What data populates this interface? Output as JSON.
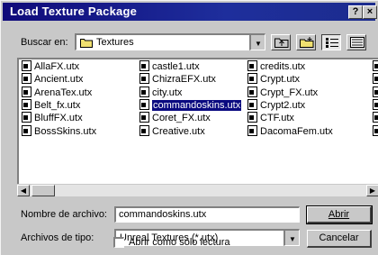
{
  "window": {
    "title": "Load Texture Package",
    "help_label": "?",
    "close_label": "×"
  },
  "lookin": {
    "label": "Buscar en:",
    "value": "Textures"
  },
  "files": {
    "col1": [
      "AllaFX.utx",
      "Ancient.utx",
      "ArenaTex.utx",
      "Belt_fx.utx",
      "BluffFX.utx",
      "BossSkins.utx"
    ],
    "col2": [
      "castle1.utx",
      "ChizraEFX.utx",
      "city.utx",
      "commandoskins.utx",
      "Coret_FX.utx",
      "Creative.utx"
    ],
    "col3": [
      "credits.utx",
      "Crypt.utx",
      "Crypt_FX.utx",
      "Crypt2.utx",
      "CTF.utx",
      "DacomaFem.utx"
    ],
    "selected": "commandoskins.utx"
  },
  "filename": {
    "label": "Nombre de archivo:",
    "value": "commandoskins.utx"
  },
  "filetype": {
    "label": "Archivos de tipo:",
    "value": "Unreal Textures (*.utx)"
  },
  "buttons": {
    "open": "Abrir",
    "cancel": "Cancelar"
  },
  "readonly": {
    "label": "Abrir como sólo lectura",
    "checked": false
  }
}
